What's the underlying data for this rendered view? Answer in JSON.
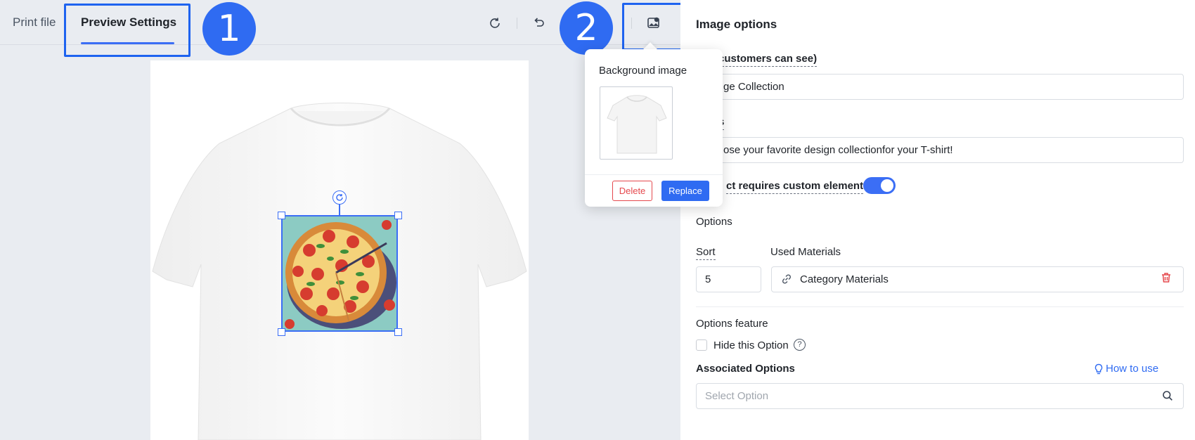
{
  "toolbar": {
    "tabs": [
      {
        "label": "Print file"
      },
      {
        "label": "Preview Settings",
        "active": true
      }
    ],
    "tool_icons": [
      "refresh-icon",
      "undo-icon",
      "image-settings-icon"
    ]
  },
  "annotations": {
    "badge1": "1",
    "badge2": "2"
  },
  "popup": {
    "title": "Background image",
    "delete_label": "Delete",
    "replace_label": "Replace"
  },
  "panel": {
    "title": "Image options",
    "name_label_partial": "customers can see)",
    "name_value_partial": "ge Collection",
    "desc_label_partial": "s",
    "desc_value_partial": "ose your favorite design collectionfor your T-shirt!",
    "toggle_label_partial": "ct requires custom element",
    "toggle_on": true,
    "options_label": "Options",
    "sort_label": "Sort",
    "sort_value": "5",
    "used_materials_label": "Used Materials",
    "used_materials_value": "Category Materials",
    "options_feature_label": "Options feature",
    "hide_option_label": "Hide this Option",
    "hide_option_checked": false,
    "associated_options_label": "Associated Options",
    "how_to_use_label": "How to use",
    "select_option_placeholder": "Select Option"
  },
  "colors": {
    "accent": "#2f6bf2",
    "danger": "#e5484d",
    "editor_bg": "#e9ecf1"
  }
}
